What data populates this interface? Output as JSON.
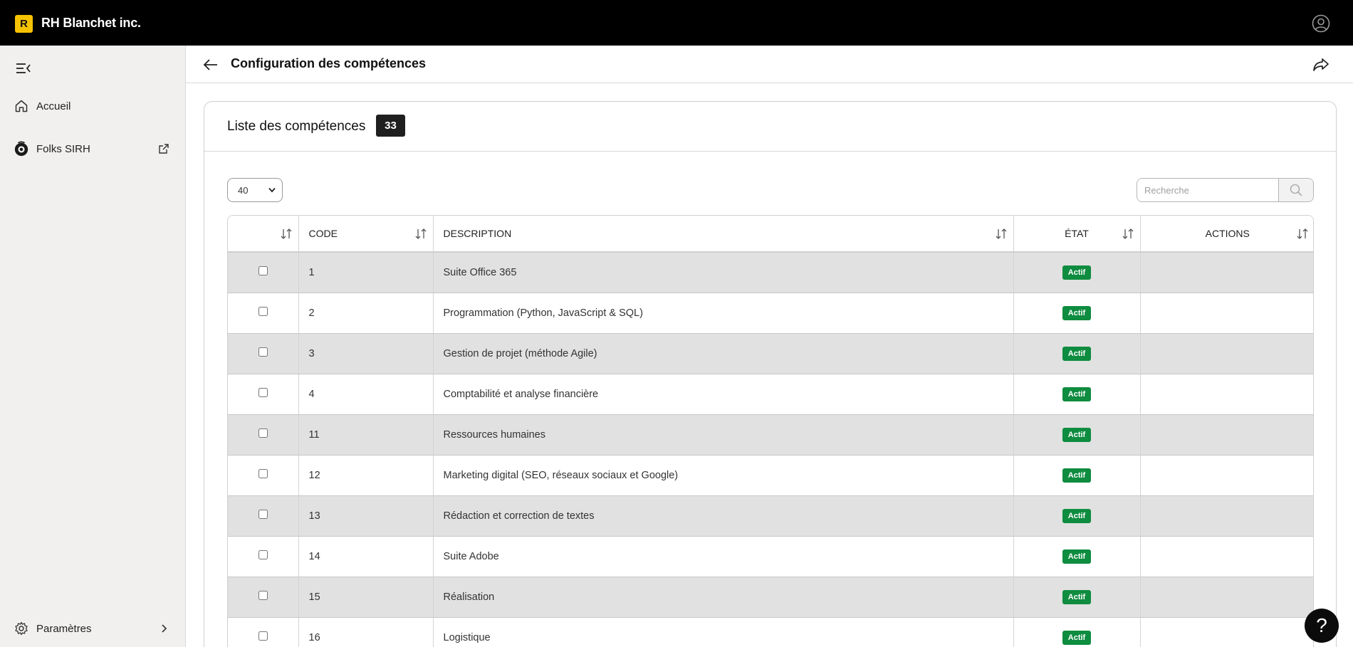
{
  "app": {
    "logo_letter": "R",
    "company_name": "RH Blanchet inc."
  },
  "sidebar": {
    "items": [
      {
        "label": "Accueil",
        "icon": "home-icon"
      },
      {
        "label": "Folks SIRH",
        "icon": "folks-icon"
      }
    ],
    "footer": {
      "label": "Paramètres",
      "icon": "gear-icon"
    }
  },
  "header": {
    "title": "Configuration des compétences"
  },
  "card": {
    "title": "Liste des compétences",
    "count": "33"
  },
  "controls": {
    "page_size": "40",
    "search_placeholder": "Recherche"
  },
  "table": {
    "columns": [
      "",
      "CODE",
      "DESCRIPTION",
      "ÉTAT",
      "ACTIONS"
    ],
    "rows": [
      {
        "code": "1",
        "description": "Suite Office 365",
        "state": "Actif"
      },
      {
        "code": "2",
        "description": "Programmation (Python, JavaScript & SQL)",
        "state": "Actif"
      },
      {
        "code": "3",
        "description": "Gestion de projet (méthode Agile)",
        "state": "Actif"
      },
      {
        "code": "4",
        "description": "Comptabilité et analyse financière",
        "state": "Actif"
      },
      {
        "code": "11",
        "description": "Ressources humaines",
        "state": "Actif"
      },
      {
        "code": "12",
        "description": "Marketing digital (SEO, réseaux sociaux et Google)",
        "state": "Actif"
      },
      {
        "code": "13",
        "description": "Rédaction et correction de textes",
        "state": "Actif"
      },
      {
        "code": "14",
        "description": "Suite Adobe",
        "state": "Actif"
      },
      {
        "code": "15",
        "description": "Réalisation",
        "state": "Actif"
      },
      {
        "code": "16",
        "description": "Logistique",
        "state": "Actif"
      }
    ]
  },
  "help": {
    "label": "?"
  },
  "colors": {
    "topbar": "#000000",
    "logo": "#f6c200",
    "status_active": "#0e8c3f",
    "row_alt": "#e1e1e1"
  }
}
